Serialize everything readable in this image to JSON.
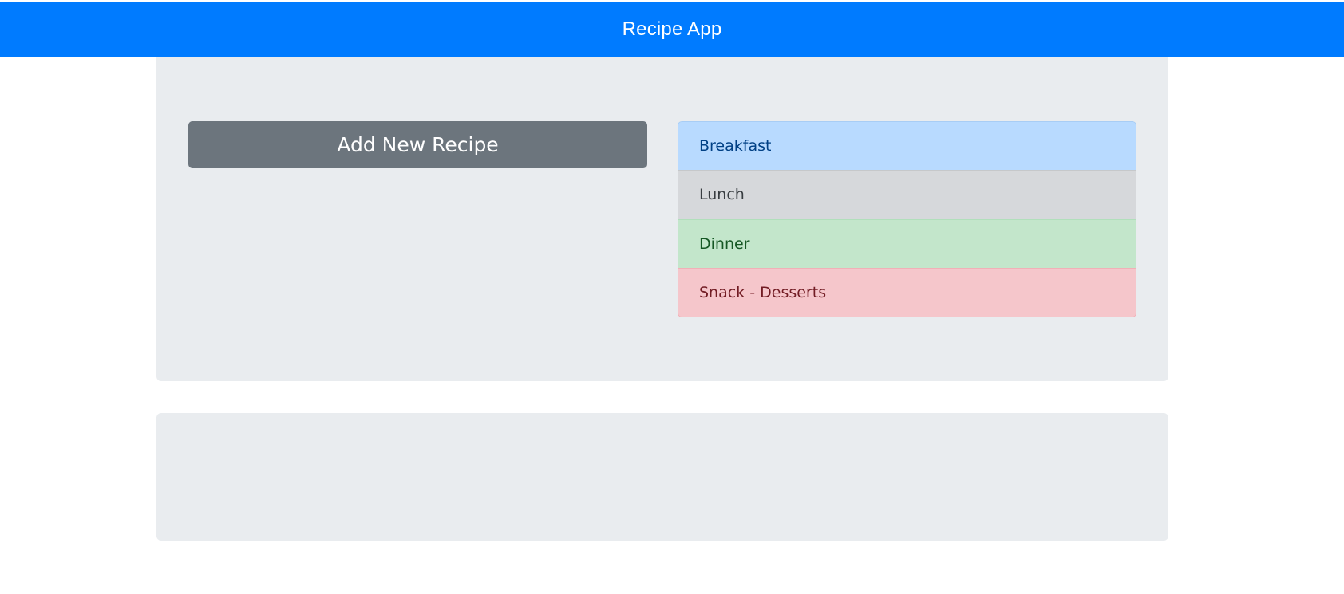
{
  "header": {
    "title": "Recipe App",
    "color": "#007bff"
  },
  "main": {
    "add_button_label": "Add New Recipe",
    "categories": [
      {
        "label": "Breakfast",
        "color": "#b8daff"
      },
      {
        "label": "Lunch",
        "color": "#d6d8db"
      },
      {
        "label": "Dinner",
        "color": "#c3e6cb"
      },
      {
        "label": "Snack - Desserts",
        "color": "#f5c6cb"
      }
    ]
  }
}
